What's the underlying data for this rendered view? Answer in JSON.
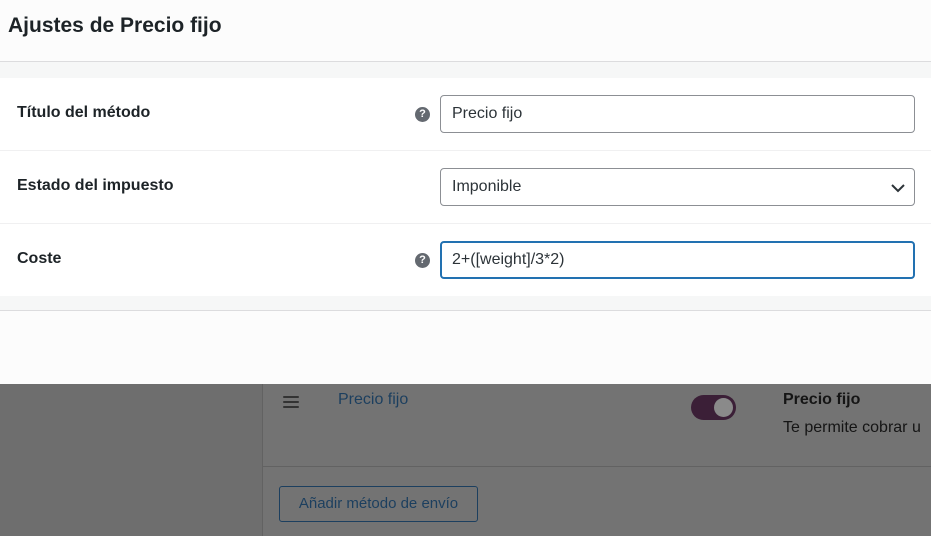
{
  "modal": {
    "title": "Ajustes de Precio fijo",
    "fields": [
      {
        "label": "Título del método",
        "value": "Precio fijo",
        "has_help": true
      },
      {
        "label": "Estado del impuesto",
        "selected": "Imponible",
        "has_help": false
      },
      {
        "label": "Coste",
        "value": "2+([weight]/3*2)",
        "has_help": true
      }
    ],
    "help_glyph": "?"
  },
  "background": {
    "method_link": "Precio fijo",
    "method_title": "Precio fijo",
    "method_description": "Te permite cobrar u",
    "add_button_label": "Añadir método de envío",
    "toggle_enabled": true
  },
  "colors": {
    "accent": "#2271b1",
    "toggle_on": "#3b1f37",
    "link": "#1c3f5f"
  },
  "icons": [
    "help-icon",
    "chevron-down-icon",
    "drag-handle-icon"
  ]
}
